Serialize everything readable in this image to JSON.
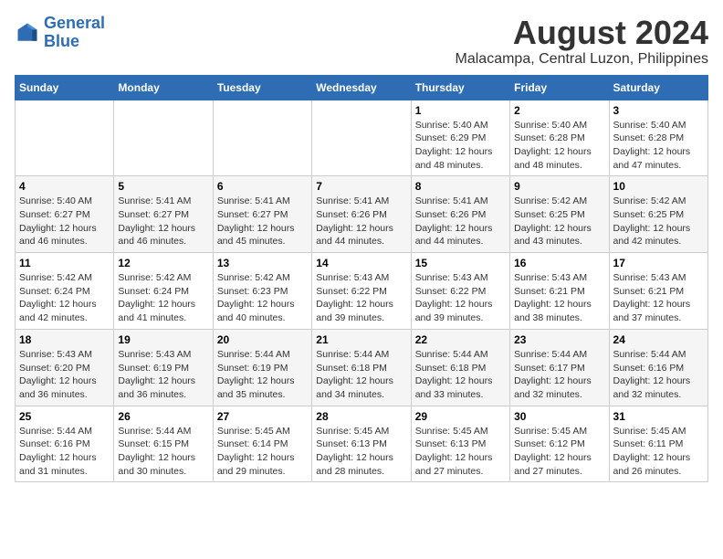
{
  "logo": {
    "line1": "General",
    "line2": "Blue"
  },
  "title": "August 2024",
  "subtitle": "Malacampa, Central Luzon, Philippines",
  "days_of_week": [
    "Sunday",
    "Monday",
    "Tuesday",
    "Wednesday",
    "Thursday",
    "Friday",
    "Saturday"
  ],
  "weeks": [
    [
      {
        "day": "",
        "info": ""
      },
      {
        "day": "",
        "info": ""
      },
      {
        "day": "",
        "info": ""
      },
      {
        "day": "",
        "info": ""
      },
      {
        "day": "1",
        "info": "Sunrise: 5:40 AM\nSunset: 6:29 PM\nDaylight: 12 hours\nand 48 minutes."
      },
      {
        "day": "2",
        "info": "Sunrise: 5:40 AM\nSunset: 6:28 PM\nDaylight: 12 hours\nand 48 minutes."
      },
      {
        "day": "3",
        "info": "Sunrise: 5:40 AM\nSunset: 6:28 PM\nDaylight: 12 hours\nand 47 minutes."
      }
    ],
    [
      {
        "day": "4",
        "info": "Sunrise: 5:40 AM\nSunset: 6:27 PM\nDaylight: 12 hours\nand 46 minutes."
      },
      {
        "day": "5",
        "info": "Sunrise: 5:41 AM\nSunset: 6:27 PM\nDaylight: 12 hours\nand 46 minutes."
      },
      {
        "day": "6",
        "info": "Sunrise: 5:41 AM\nSunset: 6:27 PM\nDaylight: 12 hours\nand 45 minutes."
      },
      {
        "day": "7",
        "info": "Sunrise: 5:41 AM\nSunset: 6:26 PM\nDaylight: 12 hours\nand 44 minutes."
      },
      {
        "day": "8",
        "info": "Sunrise: 5:41 AM\nSunset: 6:26 PM\nDaylight: 12 hours\nand 44 minutes."
      },
      {
        "day": "9",
        "info": "Sunrise: 5:42 AM\nSunset: 6:25 PM\nDaylight: 12 hours\nand 43 minutes."
      },
      {
        "day": "10",
        "info": "Sunrise: 5:42 AM\nSunset: 6:25 PM\nDaylight: 12 hours\nand 42 minutes."
      }
    ],
    [
      {
        "day": "11",
        "info": "Sunrise: 5:42 AM\nSunset: 6:24 PM\nDaylight: 12 hours\nand 42 minutes."
      },
      {
        "day": "12",
        "info": "Sunrise: 5:42 AM\nSunset: 6:24 PM\nDaylight: 12 hours\nand 41 minutes."
      },
      {
        "day": "13",
        "info": "Sunrise: 5:42 AM\nSunset: 6:23 PM\nDaylight: 12 hours\nand 40 minutes."
      },
      {
        "day": "14",
        "info": "Sunrise: 5:43 AM\nSunset: 6:22 PM\nDaylight: 12 hours\nand 39 minutes."
      },
      {
        "day": "15",
        "info": "Sunrise: 5:43 AM\nSunset: 6:22 PM\nDaylight: 12 hours\nand 39 minutes."
      },
      {
        "day": "16",
        "info": "Sunrise: 5:43 AM\nSunset: 6:21 PM\nDaylight: 12 hours\nand 38 minutes."
      },
      {
        "day": "17",
        "info": "Sunrise: 5:43 AM\nSunset: 6:21 PM\nDaylight: 12 hours\nand 37 minutes."
      }
    ],
    [
      {
        "day": "18",
        "info": "Sunrise: 5:43 AM\nSunset: 6:20 PM\nDaylight: 12 hours\nand 36 minutes."
      },
      {
        "day": "19",
        "info": "Sunrise: 5:43 AM\nSunset: 6:19 PM\nDaylight: 12 hours\nand 36 minutes."
      },
      {
        "day": "20",
        "info": "Sunrise: 5:44 AM\nSunset: 6:19 PM\nDaylight: 12 hours\nand 35 minutes."
      },
      {
        "day": "21",
        "info": "Sunrise: 5:44 AM\nSunset: 6:18 PM\nDaylight: 12 hours\nand 34 minutes."
      },
      {
        "day": "22",
        "info": "Sunrise: 5:44 AM\nSunset: 6:18 PM\nDaylight: 12 hours\nand 33 minutes."
      },
      {
        "day": "23",
        "info": "Sunrise: 5:44 AM\nSunset: 6:17 PM\nDaylight: 12 hours\nand 32 minutes."
      },
      {
        "day": "24",
        "info": "Sunrise: 5:44 AM\nSunset: 6:16 PM\nDaylight: 12 hours\nand 32 minutes."
      }
    ],
    [
      {
        "day": "25",
        "info": "Sunrise: 5:44 AM\nSunset: 6:16 PM\nDaylight: 12 hours\nand 31 minutes."
      },
      {
        "day": "26",
        "info": "Sunrise: 5:44 AM\nSunset: 6:15 PM\nDaylight: 12 hours\nand 30 minutes."
      },
      {
        "day": "27",
        "info": "Sunrise: 5:45 AM\nSunset: 6:14 PM\nDaylight: 12 hours\nand 29 minutes."
      },
      {
        "day": "28",
        "info": "Sunrise: 5:45 AM\nSunset: 6:13 PM\nDaylight: 12 hours\nand 28 minutes."
      },
      {
        "day": "29",
        "info": "Sunrise: 5:45 AM\nSunset: 6:13 PM\nDaylight: 12 hours\nand 27 minutes."
      },
      {
        "day": "30",
        "info": "Sunrise: 5:45 AM\nSunset: 6:12 PM\nDaylight: 12 hours\nand 27 minutes."
      },
      {
        "day": "31",
        "info": "Sunrise: 5:45 AM\nSunset: 6:11 PM\nDaylight: 12 hours\nand 26 minutes."
      }
    ]
  ]
}
